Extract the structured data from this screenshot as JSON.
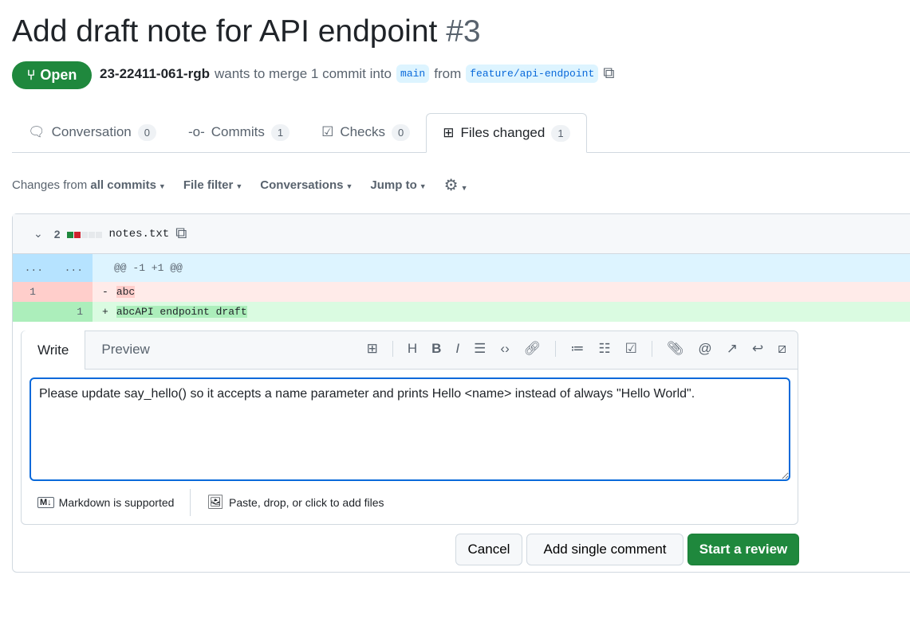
{
  "pr": {
    "title": "Add draft note for API endpoint",
    "number": "#3",
    "state": "Open",
    "author": "23-22411-061-rgb",
    "merge_text": "wants to merge 1 commit into",
    "base": "main",
    "from": "from",
    "head": "feature/api-endpoint"
  },
  "tabs": [
    {
      "label": "Conversation",
      "count": "0"
    },
    {
      "label": "Commits",
      "count": "1"
    },
    {
      "label": "Checks",
      "count": "0"
    },
    {
      "label": "Files changed",
      "count": "1"
    }
  ],
  "toolbar": {
    "changes_prefix": "Changes from",
    "changes_value": "all commits",
    "file_filter": "File filter",
    "conversations": "Conversations",
    "jump_to": "Jump to"
  },
  "file": {
    "changes": "2",
    "name": "notes.txt",
    "hunk": "@@ -1 +1 @@",
    "expand": "...",
    "del": {
      "line": "1",
      "sign": "-",
      "text": "abc"
    },
    "add": {
      "line": "1",
      "sign": "+",
      "text": "abcAPI endpoint draft"
    }
  },
  "comment": {
    "write": "Write",
    "preview": "Preview",
    "text": "Please update say_hello() so it accepts a name parameter and prints Hello <name> instead of always \"Hello World\".",
    "markdown": "Markdown is supported",
    "attach": "Paste, drop, or click to add files"
  },
  "buttons": {
    "cancel": "Cancel",
    "single": "Add single comment",
    "review": "Start a review"
  },
  "colors": {
    "green": "#1f883d",
    "blue": "#0969da",
    "del": "#ffebe9",
    "add": "#dafbe1",
    "hunk": "#ddf4ff"
  }
}
